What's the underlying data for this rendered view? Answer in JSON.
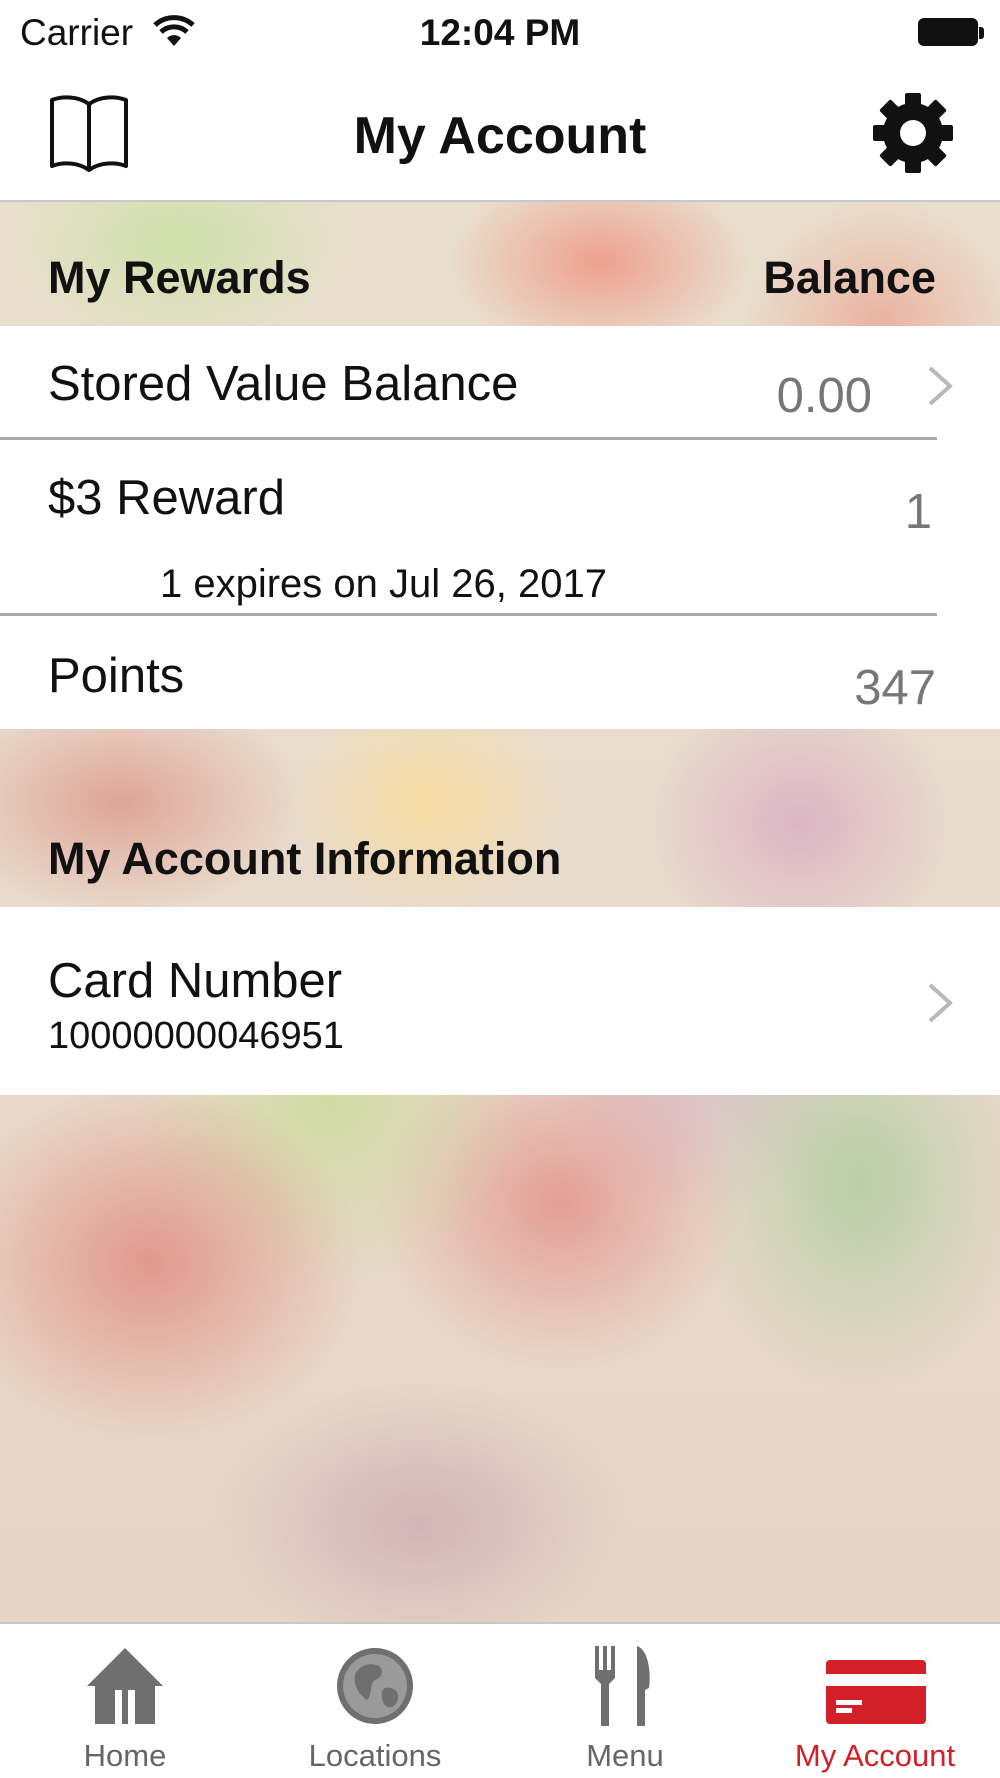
{
  "status_bar": {
    "carrier": "Carrier",
    "time": "12:04 PM"
  },
  "nav": {
    "title": "My Account",
    "left_icon": "book-icon",
    "right_icon": "gear-icon"
  },
  "rewards": {
    "header_title": "My Rewards",
    "header_right": "Balance",
    "stored_value": {
      "label": "Stored Value Balance",
      "value": "0.00"
    },
    "reward": {
      "label": "$3 Reward",
      "value": "1",
      "expiry": "1 expires on Jul 26, 2017"
    },
    "points": {
      "label": "Points",
      "value": "347"
    }
  },
  "account_info": {
    "header_title": "My Account Information",
    "card": {
      "label": "Card Number",
      "number": "10000000046951"
    }
  },
  "tabs": [
    {
      "label": "Home",
      "icon": "home-icon",
      "active": false
    },
    {
      "label": "Locations",
      "icon": "globe-icon",
      "active": false
    },
    {
      "label": "Menu",
      "icon": "fork-knife-icon",
      "active": false
    },
    {
      "label": "My Account",
      "icon": "credit-card-icon",
      "active": true
    }
  ],
  "colors": {
    "accent": "#d31f27",
    "tab_inactive": "#666666",
    "value_gray": "#777777"
  }
}
